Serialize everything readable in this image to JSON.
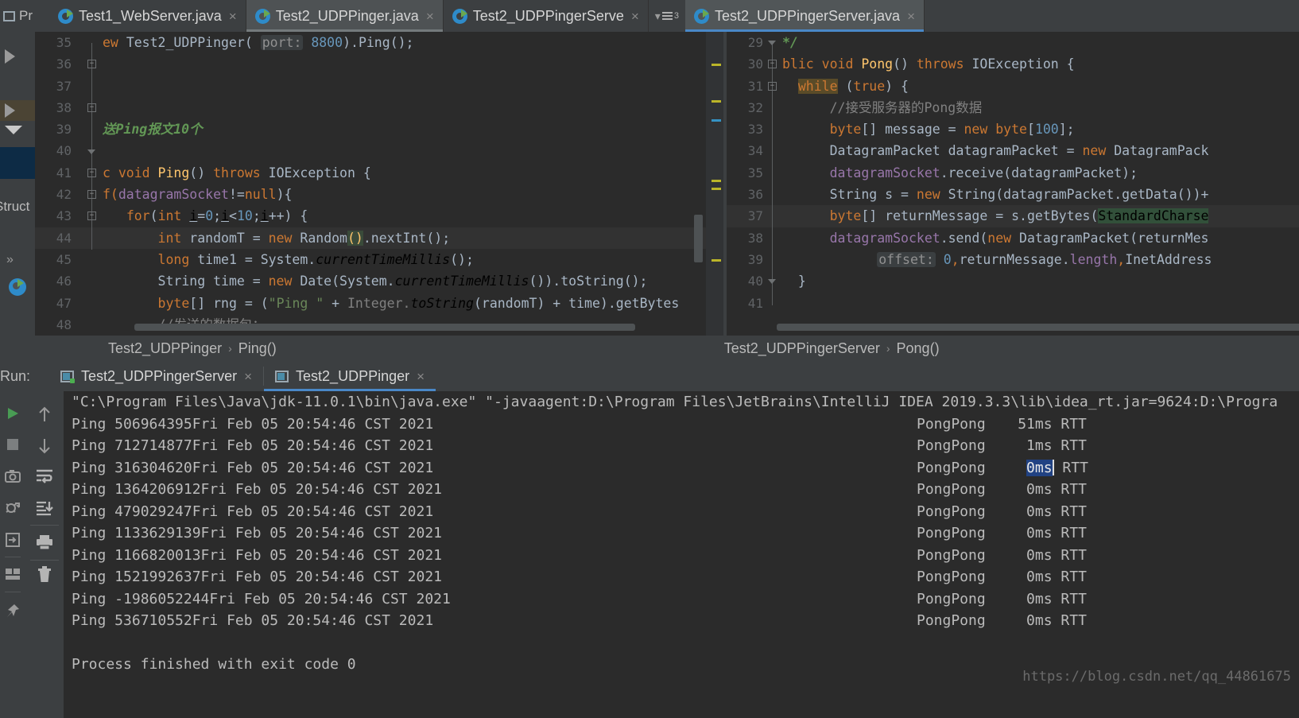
{
  "window": {
    "project_stub_label": "Pr",
    "structure_label": "Struct",
    "expand_chevron": "»",
    "watermark": "https://blog.csdn.net/qq_44861675"
  },
  "editor_tabs": [
    {
      "label": "Test1_WebServer.java",
      "icon": "java-class-icon",
      "state": "inactive",
      "close": "×"
    },
    {
      "label": "Test2_UDPPinger.java",
      "icon": "java-class-icon",
      "state": "selected",
      "close": "×"
    },
    {
      "label": "Test2_UDPPingerServe",
      "icon": "java-class-icon",
      "state": "inactive",
      "close": "×"
    },
    {
      "label": "Test2_UDPPingerServer.java",
      "icon": "java-class-icon",
      "state": "focused",
      "close": "×"
    }
  ],
  "tab_overflow": {
    "count": "3",
    "chevron": "▾"
  },
  "left_editor": {
    "file": "Test2_UDPPinger.java",
    "lines": [
      {
        "num": "35",
        "segments": [
          {
            "t": "ew ",
            "c": "kw"
          },
          {
            "t": "Test2_UDPPinger",
            "c": "txt"
          },
          {
            "t": "( ",
            "c": "txt"
          },
          {
            "t": "port:",
            "c": "hint"
          },
          {
            "t": " ",
            "c": "txt"
          },
          {
            "t": "8800",
            "c": "num"
          },
          {
            "t": ").",
            "c": "txt"
          },
          {
            "t": "Ping",
            "c": "txt"
          },
          {
            "t": "();",
            "c": "txt"
          }
        ]
      },
      {
        "num": "36",
        "segments": []
      },
      {
        "num": "37",
        "segments": []
      },
      {
        "num": "38",
        "segments": []
      },
      {
        "num": "39",
        "segments": [
          {
            "t": "送Ping报文10个",
            "c": "cmt-g"
          }
        ]
      },
      {
        "num": "40",
        "segments": []
      },
      {
        "num": "41",
        "segments": [
          {
            "t": "c ",
            "c": "kw"
          },
          {
            "t": "void ",
            "c": "kw"
          },
          {
            "t": "Ping",
            "c": "mth"
          },
          {
            "t": "() ",
            "c": "txt"
          },
          {
            "t": "throws ",
            "c": "kw"
          },
          {
            "t": "IOException {",
            "c": "txt"
          }
        ]
      },
      {
        "num": "42",
        "segments": [
          {
            "t": "f(",
            "c": "kw"
          },
          {
            "t": "datagramSocket",
            "c": "fld"
          },
          {
            "t": "!=",
            "c": "txt"
          },
          {
            "t": "null",
            "c": "kw"
          },
          {
            "t": "){",
            "c": "txt"
          }
        ]
      },
      {
        "num": "43",
        "segments": [
          {
            "t": "   ",
            "c": "txt"
          },
          {
            "t": "for",
            "c": "kw"
          },
          {
            "t": "(",
            "c": "txt"
          },
          {
            "t": "int ",
            "c": "kw"
          },
          {
            "t": "i",
            "c": "undl"
          },
          {
            "t": "=",
            "c": "txt"
          },
          {
            "t": "0",
            "c": "num"
          },
          {
            "t": ";",
            "c": "txt"
          },
          {
            "t": "i",
            "c": "undl"
          },
          {
            "t": "<",
            "c": "txt"
          },
          {
            "t": "10",
            "c": "num"
          },
          {
            "t": ";",
            "c": "txt"
          },
          {
            "t": "i",
            "c": "undl"
          },
          {
            "t": "++) {",
            "c": "txt"
          }
        ]
      },
      {
        "num": "44",
        "highlight": true,
        "segments": [
          {
            "t": "       ",
            "c": "txt"
          },
          {
            "t": "int ",
            "c": "kw"
          },
          {
            "t": "randomT = ",
            "c": "txt"
          },
          {
            "t": "new ",
            "c": "kw"
          },
          {
            "t": "Random",
            "c": "txt"
          },
          {
            "t": "()",
            "c": "sel-br"
          },
          {
            "t": ".nextInt();",
            "c": "txt"
          }
        ]
      },
      {
        "num": "45",
        "segments": [
          {
            "t": "       ",
            "c": "txt"
          },
          {
            "t": "long ",
            "c": "kw"
          },
          {
            "t": "time1 = System.",
            "c": "txt"
          },
          {
            "t": "currentTimeMillis",
            "c": "ital"
          },
          {
            "t": "();",
            "c": "txt"
          }
        ]
      },
      {
        "num": "46",
        "segments": [
          {
            "t": "       ",
            "c": "txt"
          },
          {
            "t": "String time = ",
            "c": "txt"
          },
          {
            "t": "new ",
            "c": "kw"
          },
          {
            "t": "Date(System.",
            "c": "txt"
          },
          {
            "t": "currentTimeMillis",
            "c": "ital"
          },
          {
            "t": "()).toString();",
            "c": "txt"
          }
        ]
      },
      {
        "num": "47",
        "segments": [
          {
            "t": "       ",
            "c": "txt"
          },
          {
            "t": "byte",
            "c": "kw"
          },
          {
            "t": "[] rng = (",
            "c": "txt"
          },
          {
            "t": "\"Ping \"",
            "c": "str"
          },
          {
            "t": " + ",
            "c": "txt"
          },
          {
            "t": "Integer.",
            "c": "cmt"
          },
          {
            "t": "toString",
            "c": "ital"
          },
          {
            "t": "(randomT) + time).getBytes",
            "c": "txt"
          }
        ]
      },
      {
        "num": "48",
        "segments": [
          {
            "t": "       ",
            "c": "txt"
          },
          {
            "t": "//发送的数据包：",
            "c": "cmt"
          }
        ]
      }
    ],
    "breadcrumb": [
      "Test2_UDPPinger",
      "Ping()"
    ],
    "breadcrumb_sep": "›"
  },
  "right_editor": {
    "file": "Test2_UDPPingerServer.java",
    "lines": [
      {
        "num": "29",
        "segments": [
          {
            "t": "*/",
            "c": "cmt-g"
          }
        ]
      },
      {
        "num": "30",
        "segments": [
          {
            "t": "blic ",
            "c": "kw"
          },
          {
            "t": "void ",
            "c": "kw"
          },
          {
            "t": "Pong",
            "c": "mth"
          },
          {
            "t": "() ",
            "c": "txt"
          },
          {
            "t": "throws ",
            "c": "kw"
          },
          {
            "t": "IOException {",
            "c": "txt"
          }
        ]
      },
      {
        "num": "31",
        "segments": [
          {
            "t": "  ",
            "c": "txt"
          },
          {
            "t": "while",
            "c": "kw-hl"
          },
          {
            "t": " (",
            "c": "txt"
          },
          {
            "t": "true",
            "c": "kw"
          },
          {
            "t": ") {",
            "c": "txt"
          }
        ]
      },
      {
        "num": "32",
        "segments": [
          {
            "t": "      ",
            "c": "txt"
          },
          {
            "t": "//接受服务器的Pong数据",
            "c": "cmt"
          }
        ]
      },
      {
        "num": "33",
        "segments": [
          {
            "t": "      ",
            "c": "txt"
          },
          {
            "t": "byte",
            "c": "kw"
          },
          {
            "t": "[] message = ",
            "c": "txt"
          },
          {
            "t": "new ",
            "c": "kw"
          },
          {
            "t": "byte",
            "c": "kw"
          },
          {
            "t": "[",
            "c": "txt"
          },
          {
            "t": "100",
            "c": "num"
          },
          {
            "t": "];",
            "c": "txt"
          }
        ]
      },
      {
        "num": "34",
        "segments": [
          {
            "t": "      ",
            "c": "txt"
          },
          {
            "t": "DatagramPacket datagramPacket = ",
            "c": "txt"
          },
          {
            "t": "new ",
            "c": "kw"
          },
          {
            "t": "DatagramPack",
            "c": "txt"
          }
        ]
      },
      {
        "num": "35",
        "segments": [
          {
            "t": "      ",
            "c": "txt"
          },
          {
            "t": "datagramSocket",
            "c": "fld"
          },
          {
            "t": ".receive(datagramPacket);",
            "c": "txt"
          }
        ]
      },
      {
        "num": "36",
        "segments": [
          {
            "t": "      ",
            "c": "txt"
          },
          {
            "t": "String s = ",
            "c": "txt"
          },
          {
            "t": "new ",
            "c": "kw"
          },
          {
            "t": "String(datagramPacket.getData())+",
            "c": "txt"
          }
        ]
      },
      {
        "num": "37",
        "highlight": true,
        "segments": [
          {
            "t": "      ",
            "c": "txt"
          },
          {
            "t": "byte",
            "c": "kw"
          },
          {
            "t": "[] returnMessage = s.getBytes(",
            "c": "txt"
          },
          {
            "t": "StandardCharse",
            "c": "sel-gr"
          }
        ]
      },
      {
        "num": "38",
        "segments": [
          {
            "t": "      ",
            "c": "txt"
          },
          {
            "t": "datagramSocket",
            "c": "fld"
          },
          {
            "t": ".send(",
            "c": "txt"
          },
          {
            "t": "new ",
            "c": "kw"
          },
          {
            "t": "DatagramPacket(returnMes",
            "c": "txt"
          }
        ]
      },
      {
        "num": "39",
        "segments": [
          {
            "t": "            ",
            "c": "txt"
          },
          {
            "t": "offset:",
            "c": "hint"
          },
          {
            "t": " ",
            "c": "txt"
          },
          {
            "t": "0",
            "c": "num"
          },
          {
            "t": ",",
            "c": "kw"
          },
          {
            "t": "returnMessage",
            "c": "txt"
          },
          {
            "t": ".",
            "c": "txt"
          },
          {
            "t": "length",
            "c": "fld"
          },
          {
            "t": ",",
            "c": "kw"
          },
          {
            "t": "InetAddress",
            "c": "txt"
          }
        ]
      },
      {
        "num": "40",
        "segments": [
          {
            "t": "  }",
            "c": "txt"
          }
        ]
      },
      {
        "num": "41",
        "segments": []
      }
    ],
    "breadcrumb": [
      "Test2_UDPPingerServer",
      "Pong()"
    ],
    "breadcrumb_sep": "›"
  },
  "run_panel": {
    "title": "Run:",
    "tabs": [
      {
        "label": "Test2_UDPPingerServer",
        "icon": "run-config-icon",
        "active": false,
        "running": true,
        "close": "×"
      },
      {
        "label": "Test2_UDPPinger",
        "icon": "run-config-icon",
        "active": true,
        "running": false,
        "close": "×"
      }
    ],
    "toolbar_left": [
      {
        "name": "rerun-icon",
        "glyph": "▶"
      },
      {
        "name": "stop-icon",
        "glyph": "■"
      },
      {
        "name": "screenshot-icon",
        "glyph": "camera"
      },
      {
        "name": "thread-dump-icon",
        "glyph": "bug"
      },
      {
        "name": "export-icon",
        "glyph": "⇥"
      },
      {
        "name": "layout-icon",
        "glyph": "layout"
      },
      {
        "name": "pin-icon",
        "glyph": "✦"
      }
    ],
    "toolbar_right": [
      {
        "name": "up-arrow-icon",
        "glyph": "↑"
      },
      {
        "name": "down-arrow-icon",
        "glyph": "↓"
      },
      {
        "name": "soft-wrap-icon",
        "glyph": "wrap"
      },
      {
        "name": "scroll-to-end-icon",
        "glyph": "scrollend"
      },
      {
        "name": "print-icon",
        "glyph": "printer"
      },
      {
        "name": "clear-all-icon",
        "glyph": "trash"
      }
    ]
  },
  "console": {
    "command_line": "\"C:\\Program Files\\Java\\jdk-11.0.1\\bin\\java.exe\" \"-javaagent:D:\\Program Files\\JetBrains\\IntelliJ IDEA 2019.3.3\\lib\\idea_rt.jar=9624:D:\\Progra",
    "rows": [
      {
        "ping": "Ping 506964395Fri Feb 05 20:54:46 CST 2021",
        "pong": "PongPong",
        "rtt": "51ms RTT",
        "rtt_value": "51ms",
        "selected": false
      },
      {
        "ping": "Ping 712714877Fri Feb 05 20:54:46 CST 2021",
        "pong": "PongPong",
        "rtt": "1ms RTT",
        "rtt_value": "1ms",
        "selected": false
      },
      {
        "ping": "Ping 316304620Fri Feb 05 20:54:46 CST 2021",
        "pong": "PongPong",
        "rtt": "0ms RTT",
        "rtt_value": "0ms",
        "selected": true
      },
      {
        "ping": "Ping 1364206912Fri Feb 05 20:54:46 CST 2021",
        "pong": "PongPong",
        "rtt": "0ms RTT",
        "rtt_value": "0ms",
        "selected": false
      },
      {
        "ping": "Ping 479029247Fri Feb 05 20:54:46 CST 2021",
        "pong": "PongPong",
        "rtt": "0ms RTT",
        "rtt_value": "0ms",
        "selected": false
      },
      {
        "ping": "Ping 1133629139Fri Feb 05 20:54:46 CST 2021",
        "pong": "PongPong",
        "rtt": "0ms RTT",
        "rtt_value": "0ms",
        "selected": false
      },
      {
        "ping": "Ping 1166820013Fri Feb 05 20:54:46 CST 2021",
        "pong": "PongPong",
        "rtt": "0ms RTT",
        "rtt_value": "0ms",
        "selected": false
      },
      {
        "ping": "Ping 1521992637Fri Feb 05 20:54:46 CST 2021",
        "pong": "PongPong",
        "rtt": "0ms RTT",
        "rtt_value": "0ms",
        "selected": false
      },
      {
        "ping": "Ping -1986052244Fri Feb 05 20:54:46 CST 2021",
        "pong": "PongPong",
        "rtt": "0ms RTT",
        "rtt_value": "0ms",
        "selected": false
      },
      {
        "ping": "Ping 536710552Fri Feb 05 20:54:46 CST 2021",
        "pong": "PongPong",
        "rtt": "0ms RTT",
        "rtt_value": "0ms",
        "selected": false
      }
    ],
    "exit_message": "Process finished with exit code 0"
  },
  "colors": {
    "background": "#2b2b2b",
    "chrome": "#3c3f41",
    "accent_blue": "#4a88c7",
    "selection_blue": "#214283",
    "keyword_orange": "#cc7832",
    "string_green": "#6a8759",
    "comment_gray": "#808080",
    "field_purple": "#9876aa",
    "number_blue": "#6897bb",
    "method_yellow": "#ffc66d",
    "text_default": "#a9b7c6"
  }
}
